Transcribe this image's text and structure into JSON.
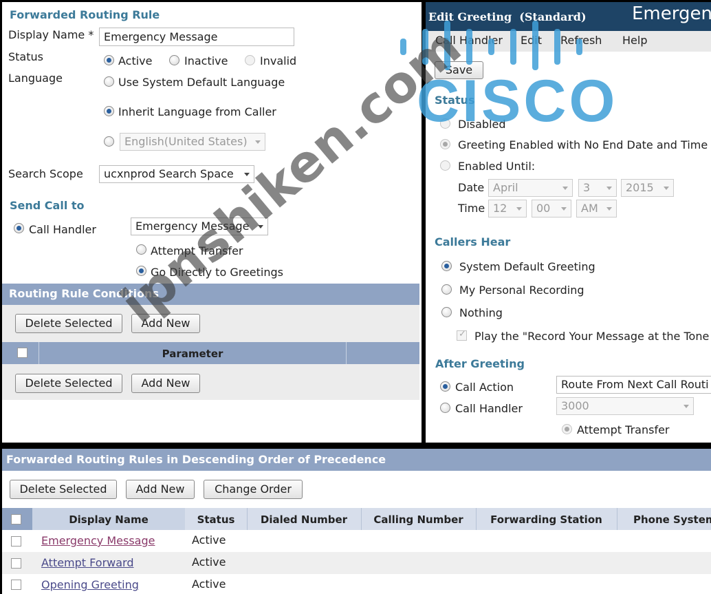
{
  "routing_rule": {
    "title": "Forwarded Routing Rule",
    "display_name_label": "Display Name *",
    "display_name_value": "Emergency Message",
    "status_label": "Status",
    "status_options": [
      "Active",
      "Inactive",
      "Invalid"
    ],
    "status_selected": "Active",
    "language_label": "Language",
    "language_use_system": "Use System Default Language",
    "language_inherit": "Inherit Language from Caller",
    "language_select_value": "English(United States)",
    "search_scope_label": "Search Scope",
    "search_scope_value": "ucxnprod Search Space",
    "send_call_to_title": "Send Call to",
    "call_handler_label": "Call Handler",
    "call_handler_value": "Emergency Message",
    "attempt_transfer": "Attempt Transfer",
    "go_directly": "Go Directly to Greetings"
  },
  "conditions": {
    "title": "Routing Rule Conditions",
    "delete_selected": "Delete Selected",
    "add_new": "Add New",
    "parameter_header": "Parameter"
  },
  "greeting": {
    "title": "Edit Greeting  (Standard)",
    "title_right": "Emergen",
    "menu": [
      "Call Handler",
      "Edit",
      "Refresh",
      "Help"
    ],
    "save": "Save",
    "status_title": "Status",
    "disabled": "Disabled",
    "enabled_no_end": "Greeting Enabled with No End Date and Time",
    "enabled_until": "Enabled Until:",
    "date_label": "Date",
    "date_month": "April",
    "date_day": "3",
    "date_year": "2015",
    "time_label": "Time",
    "time_hour": "12",
    "time_min": "00",
    "time_ampm": "AM",
    "callers_hear_title": "Callers Hear",
    "system_default": "System Default Greeting",
    "personal_recording": "My Personal Recording",
    "nothing": "Nothing",
    "play_record": "Play the \"Record Your Message at the Tone",
    "after_greeting_title": "After Greeting",
    "call_action_label": "Call Action",
    "call_action_value": "Route From Next Call Routi",
    "call_handler_label": "Call Handler",
    "call_handler_value": "3000",
    "attempt_transfer": "Attempt Transfer"
  },
  "rules_list": {
    "title": "Forwarded Routing Rules in Descending Order of Precedence",
    "delete_selected": "Delete Selected",
    "add_new": "Add New",
    "change_order": "Change Order",
    "columns": [
      "Display Name",
      "Status",
      "Dialed Number",
      "Calling Number",
      "Forwarding Station",
      "Phone System"
    ],
    "rows": [
      {
        "name": "Emergency Message",
        "status": "Active"
      },
      {
        "name": "Attempt Forward",
        "status": "Active"
      },
      {
        "name": "Opening Greeting",
        "status": "Active"
      }
    ]
  },
  "overlay": {
    "logo_text": "CISCO",
    "watermark_text": "ipnshiken.com"
  },
  "colors": {
    "section_header": "#3c7a99",
    "table_bar": "#8fa3c3",
    "greeting_bar": "#1e4466",
    "logo_blue": "#3f9fd8"
  }
}
